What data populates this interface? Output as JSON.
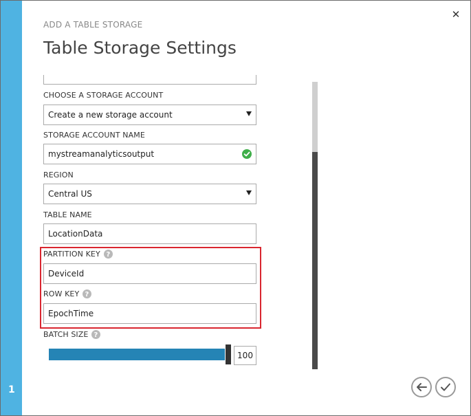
{
  "step_number": "1",
  "header": {
    "subtitle": "ADD A TABLE STORAGE",
    "title": "Table Storage Settings"
  },
  "form": {
    "storage_account": {
      "label": "CHOOSE A STORAGE ACCOUNT",
      "value": "Create a new storage account"
    },
    "storage_account_name": {
      "label": "STORAGE ACCOUNT NAME",
      "value": "mystreamanalyticsoutput"
    },
    "region": {
      "label": "REGION",
      "value": "Central US"
    },
    "table_name": {
      "label": "TABLE NAME",
      "value": "LocationData"
    },
    "partition_key": {
      "label": "PARTITION KEY",
      "value": "DeviceId"
    },
    "row_key": {
      "label": "ROW KEY",
      "value": "EpochTime"
    },
    "batch_size": {
      "label": "BATCH SIZE",
      "value": "100",
      "fill_fraction": 1.0
    }
  },
  "colors": {
    "accent_bar": "#4fb3e2",
    "slider_fill": "#2584b5",
    "highlight": "#d9262f",
    "valid_check": "#3fae49"
  },
  "icons": {
    "close": "close-icon",
    "valid": "check-circle-icon",
    "help": "question-mark-icon",
    "back": "back-arrow-icon",
    "confirm": "checkmark-icon"
  }
}
